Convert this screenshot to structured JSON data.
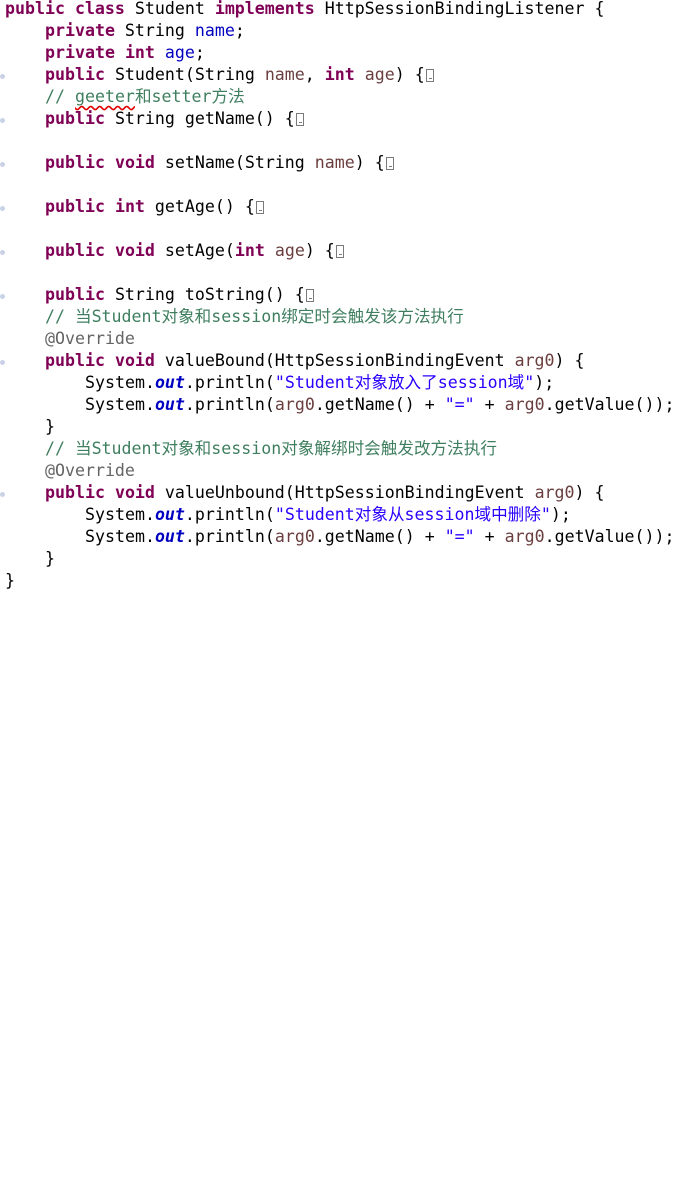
{
  "code": {
    "class_decl": {
      "kw1": "public",
      "kw2": "class",
      "name": " Student ",
      "kw3": "implements",
      "iface": " HttpSessionBindingListener {"
    },
    "field_name": {
      "kw": "private",
      "type": " String ",
      "name": "name",
      ";": ";"
    },
    "field_age": {
      "kw": "private",
      "type": "int",
      "name": "age",
      ";": ";"
    },
    "ctor": {
      "kw": "public",
      "sig1": " Student(String ",
      "p1": "name",
      ",": ", ",
      "kw2": "int",
      "sp": " ",
      "p2": "age",
      ")": ") {"
    },
    "comment_getter": {
      "prefix": "// ",
      "misspelled": "geeter",
      "rest": "和setter方法"
    },
    "getName": {
      "kw": "public",
      "rest": " String getName() {"
    },
    "setName": {
      "kw": "public",
      "kw2": "void",
      "rest1": " setName(String ",
      "p": "name",
      "rest2": ") {"
    },
    "getAge": {
      "kw": "public",
      "kw2": "int",
      "rest": " getAge() {"
    },
    "setAge": {
      "kw": "public",
      "kw2": "void",
      "rest1": " setAge(",
      "kw3": "int",
      "sp": " ",
      "p": "age",
      "rest2": ") {"
    },
    "toString": {
      "kw": "public",
      "rest": " String toString() {"
    },
    "comment_bound": "// 当Student对象和session绑定时会触发该方法执行",
    "annotation1": "@Override",
    "valueBound": {
      "kw": "public",
      "kw2": "void",
      "rest1": " valueBound(HttpSessionBindingEvent ",
      "p": "arg0",
      "rest2": ") {"
    },
    "vb_line1": {
      "sys": "System.",
      "out": "out",
      "mid": ".println(",
      "str": "\"Student对象放入了session域\"",
      "end": ");"
    },
    "vb_line2": {
      "sys": "System.",
      "out": "out",
      "mid": ".println(",
      "a1": "arg0",
      "m1": ".getName() + ",
      "str": "\"=\"",
      "m2": " + ",
      "a2": "arg0",
      "end": ".getValue());"
    },
    "close_brace": "}",
    "comment_unbound": "// 当Student对象和session对象解绑时会触发改方法执行",
    "annotation2": "@Override",
    "valueUnbound": {
      "kw": "public",
      "kw2": "void",
      "rest1": " valueUnbound(HttpSessionBindingEvent ",
      "p": "arg0",
      "rest2": ") {"
    },
    "vu_line1": {
      "sys": "System.",
      "out": "out",
      "mid": ".println(",
      "str": "\"Student对象从session域中删除\"",
      "end": ");"
    },
    "vu_line2": {
      "sys": "System.",
      "out": "out",
      "mid": ".println(",
      "a1": "arg0",
      "m1": ".getName() + ",
      "str": "\"=\"",
      "m2": " + ",
      "a2": "arg0",
      "end": ".getValue());"
    },
    "class_close": "}"
  }
}
